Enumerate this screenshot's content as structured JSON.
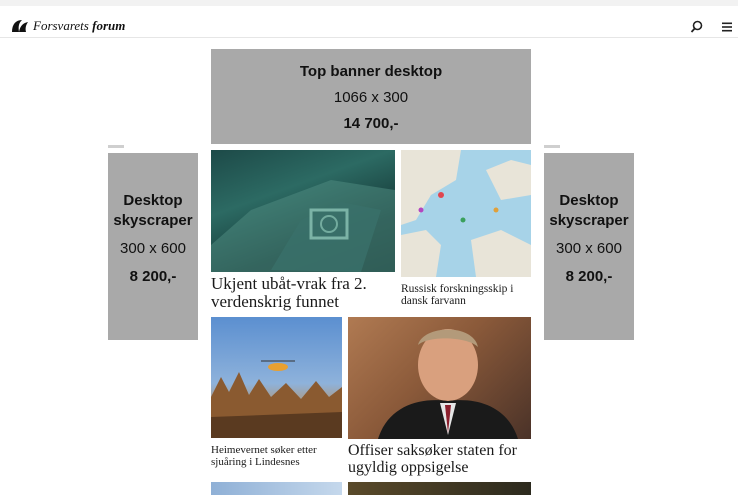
{
  "header": {
    "logo_text_prefix": "Forsvarets",
    "logo_text_bold": "forum",
    "search_icon": "search-icon",
    "menu_icon": "hamburger-menu-icon"
  },
  "ads": {
    "top_banner": {
      "title": "Top banner  desktop",
      "size": "1066 x 300",
      "price": "14 700,-"
    },
    "skyscraper_left": {
      "title_line1": "Desktop",
      "title_line2": "skyscraper",
      "size": "300 x 600",
      "price": "8 200,-"
    },
    "skyscraper_right": {
      "title_line1": "Desktop",
      "title_line2": "skyscraper",
      "size": "300 x 600",
      "price": "8 200,-"
    }
  },
  "articles": [
    {
      "headline": "Ukjent ubåt-vrak fra 2. verdenskrig funnet"
    },
    {
      "headline": "Russisk forskningsskip i dansk farvann"
    },
    {
      "headline": "Heimevernet søker etter sjuåring i Lindesnes"
    },
    {
      "headline": "Offiser saksøker staten for ugyldig oppsigelse"
    }
  ],
  "colors": {
    "ad_gray": "#a9a9a9",
    "text": "#111111"
  }
}
